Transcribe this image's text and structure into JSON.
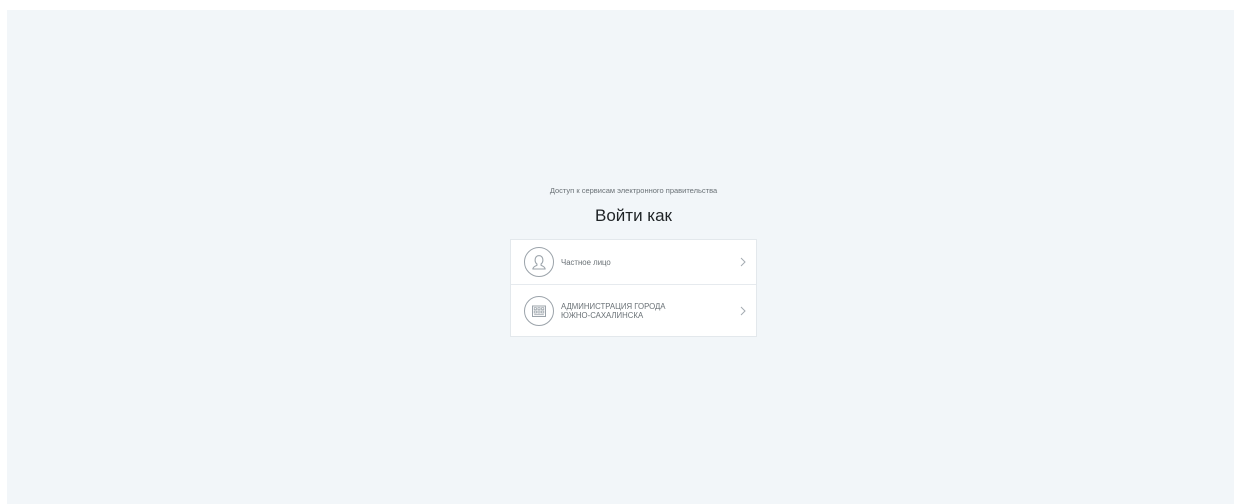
{
  "login": {
    "subtitle": "Доступ к сервисам электронного правительства",
    "title": "Войти как",
    "options": [
      {
        "label": "Частное лицо",
        "icon": "person-icon"
      },
      {
        "label_lines": [
          "АДМИНИСТРАЦИЯ ГОРОДА",
          "ЮЖНО-САХАЛИНСКА"
        ],
        "icon": "building-icon"
      }
    ]
  },
  "colors": {
    "background": "#f2f6f9",
    "card": "#ffffff",
    "text_muted": "#6a7176",
    "text_title": "#1f2326",
    "icon_stroke": "#9ba3aa"
  }
}
